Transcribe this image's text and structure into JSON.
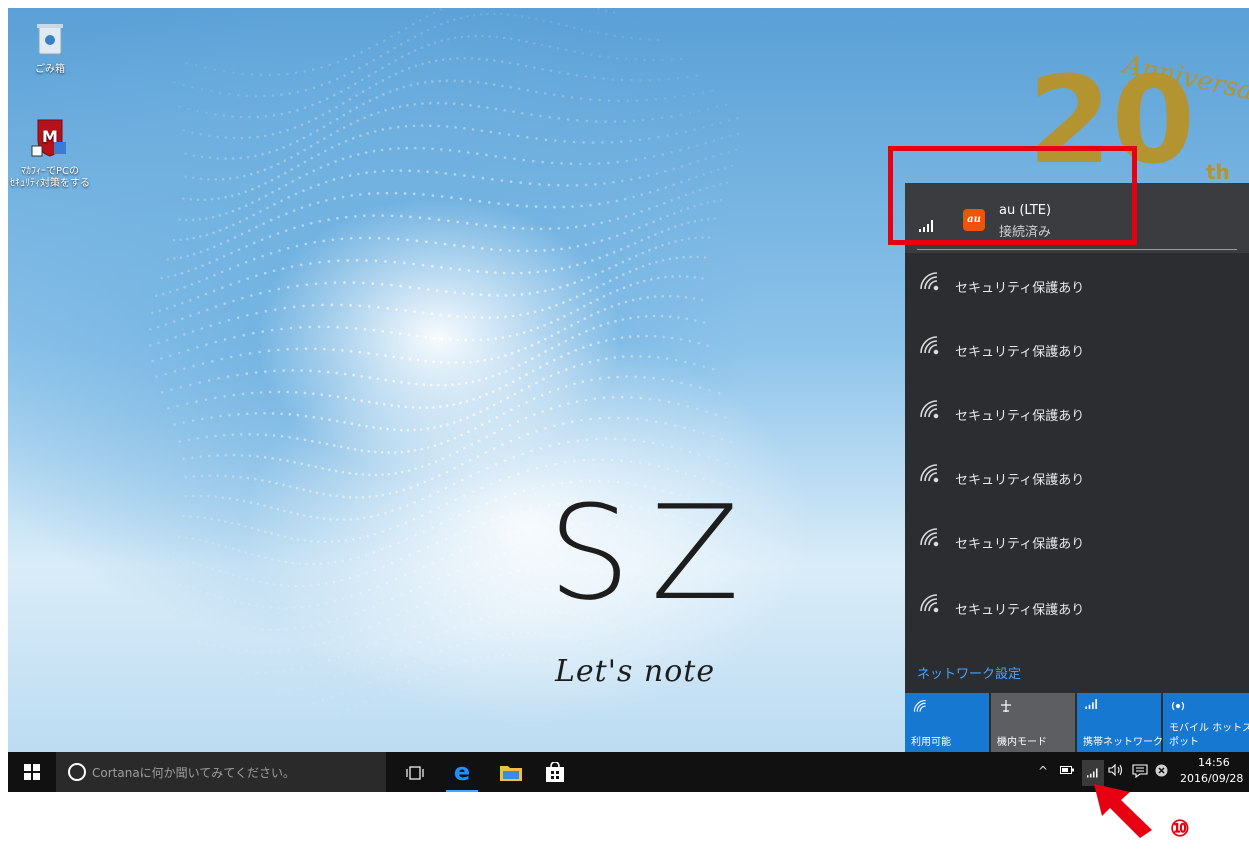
{
  "desktop": {
    "icons": [
      {
        "id": "recycle-bin",
        "label": "ごみ箱"
      },
      {
        "id": "mcafee",
        "label_line1": "ﾏｶﾌｨｰでPCの",
        "label_line2": "ｾｷｭﾘﾃｨ対策をする"
      }
    ],
    "wallpaper": {
      "model": "SZ",
      "brand": "Let's note"
    },
    "anniversary": {
      "number": "20",
      "script": "Anniversary",
      "suffix": "th",
      "color": "#b39430"
    }
  },
  "network_flyout": {
    "connected": {
      "name": "au (LTE)",
      "status": "接続済み",
      "icon": "au-logo",
      "signal_icon": "cellular-bars-icon"
    },
    "wifi_networks": [
      {
        "status": "セキュリティ保護あり"
      },
      {
        "status": "セキュリティ保護あり"
      },
      {
        "status": "セキュリティ保護あり"
      },
      {
        "status": "セキュリティ保護あり"
      },
      {
        "status": "セキュリティ保護あり"
      },
      {
        "status": "セキュリティ保護あり"
      }
    ],
    "settings_link": "ネットワーク設定",
    "tiles": [
      {
        "label": "利用可能",
        "icon": "wifi-icon",
        "state": "on"
      },
      {
        "label": "機内モード",
        "icon": "airplane-icon",
        "state": "off"
      },
      {
        "label": "携帯ネットワーク",
        "icon": "cellular-icon",
        "state": "on"
      },
      {
        "label": "モバイル ホットス\nポット",
        "label_line1": "モバイル ホットス",
        "label_line2": "ポット",
        "icon": "hotspot-icon",
        "state": "on"
      }
    ]
  },
  "taskbar": {
    "search_placeholder": "Cortanaに何か聞いてみてください。",
    "clock": {
      "time": "14:56",
      "date": "2016/09/28"
    }
  },
  "annotation": {
    "step": "⑩",
    "color": "#e60012"
  },
  "colors": {
    "accent": "#1778d2",
    "flyout_bg": "#2b2d30",
    "highlight": "#e60012"
  }
}
